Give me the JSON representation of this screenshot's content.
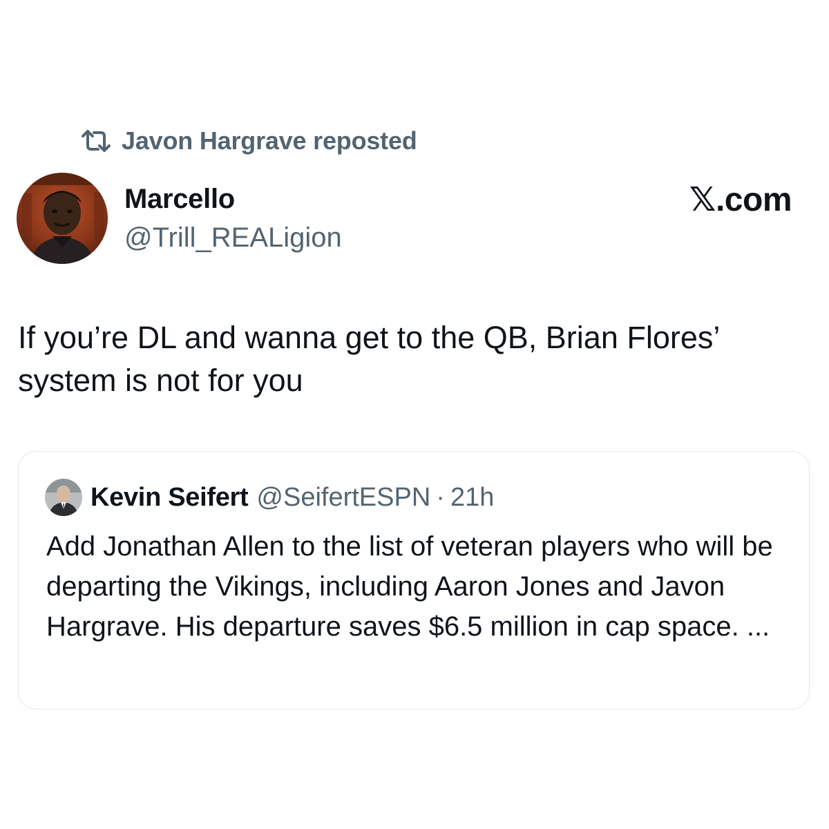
{
  "repost": {
    "icon": "repost-icon",
    "text": "Javon Hargrave reposted"
  },
  "post": {
    "author": {
      "name": "Marcello",
      "handle": "@Trill_REALigion",
      "avatar": "avatar"
    },
    "brand": "𝕏.com",
    "text": "If you’re DL and wanna get to the QB, Brian Flores’ system is not for you"
  },
  "quoted_post": {
    "author": {
      "name": "Kevin Seifert",
      "handle": "@SeifertESPN",
      "avatar": "avatar"
    },
    "separator": "·",
    "time": "21h",
    "text": "Add Jonathan Allen to the list of veteran players who will be departing the Vikings, including Aaron Jones and Javon Hargrave. His departure saves $6.5 million in cap space. ..."
  },
  "colors": {
    "text_primary": "#0f1419",
    "text_secondary": "#536471",
    "border": "#e3e7ea",
    "background": "#ffffff"
  }
}
